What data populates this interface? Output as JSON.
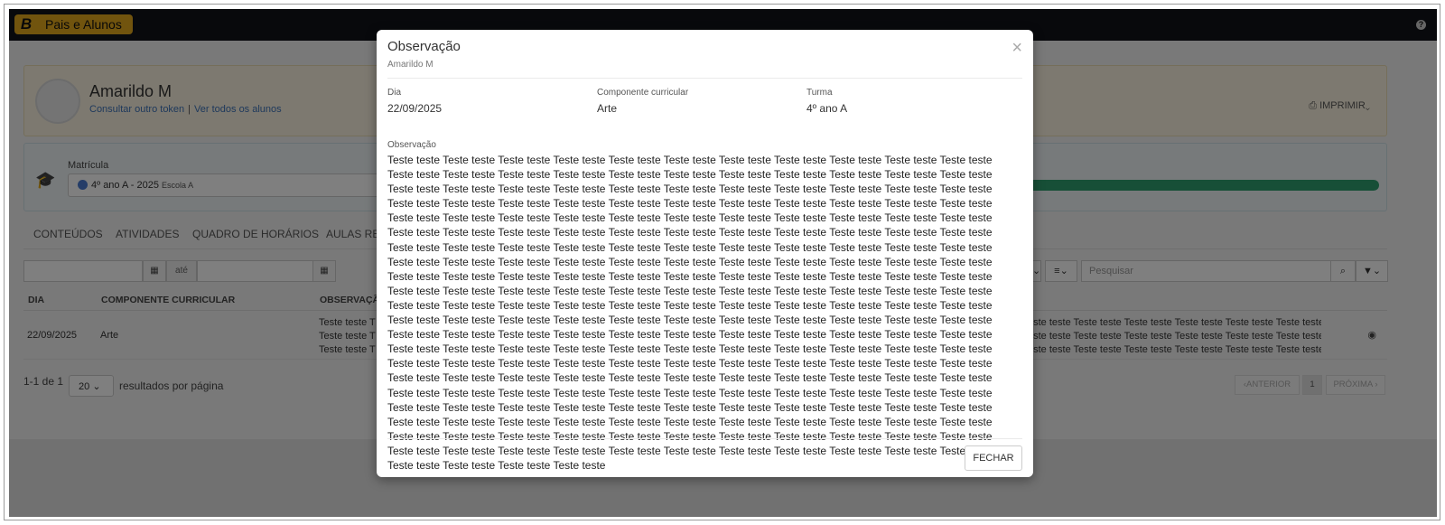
{
  "app": {
    "brand_letter": "B",
    "brand_name": "Pais e Alunos",
    "help_icon": "question-circle-icon"
  },
  "student": {
    "name": "Amarildo M",
    "link_token": "Consultar outro token",
    "link_separator": "|",
    "link_all": "Ver todos os alunos",
    "print_label": "IMPRIMIR"
  },
  "enrollment": {
    "label": "Matrícula",
    "value": "4º ano A - 2025",
    "school": "Escola A"
  },
  "tabs": [
    "CONTEÚDOS",
    "ATIVIDADES",
    "QUADRO DE HORÁRIOS",
    "AULAS REA"
  ],
  "filters": {
    "until_label": "até",
    "search_placeholder": "Pesquisar"
  },
  "table": {
    "headers": {
      "dia": "DIA",
      "componente": "COMPONENTE CURRICULAR",
      "observacao": "OBSERVAÇÃO"
    },
    "rows": [
      {
        "dia": "22/09/2025",
        "componente": "Arte",
        "obs_line1": "Teste teste T",
        "obs_line2": "Teste teste T",
        "obs_line3": "Teste teste T",
        "obs_tail1": "este teste Teste teste Teste teste Teste teste Teste teste Teste teste",
        "obs_tail2": "este teste Teste teste Teste teste Teste teste Teste teste Teste teste",
        "obs_tail3": "este teste Teste teste Teste teste Teste teste Teste teste Teste teste..."
      }
    ]
  },
  "pagination": {
    "summary": "1-1 de 1",
    "per_page": "20",
    "per_page_label": "resultados por página",
    "prev": "ANTERIOR",
    "current": "1",
    "next": "PRÓXIMA"
  },
  "modal": {
    "title": "Observação",
    "subtitle": "Amarildo M",
    "dia_label": "Dia",
    "dia_value": "22/09/2025",
    "comp_label": "Componente curricular",
    "comp_value": "Arte",
    "turma_label": "Turma",
    "turma_value": "4º ano A",
    "obs_label": "Observação",
    "obs_text": "Teste teste Teste teste Teste teste Teste teste Teste teste Teste teste Teste teste Teste teste Teste teste Teste teste Teste teste Teste teste Teste teste Teste teste Teste teste Teste teste Teste teste Teste teste Teste teste Teste teste Teste teste Teste teste Teste teste Teste teste Teste teste Teste teste Teste teste Teste teste Teste teste Teste teste Teste teste Teste teste Teste teste Teste teste Teste teste Teste teste Teste teste Teste teste Teste teste Teste teste Teste teste Teste teste Teste teste Teste teste Teste teste Teste teste Teste teste Teste teste Teste teste Teste teste Teste teste Teste teste Teste teste Teste teste Teste teste Teste teste Teste teste Teste teste Teste teste Teste teste Teste teste Teste teste Teste teste Teste teste Teste teste Teste teste Teste teste Teste teste Teste teste Teste teste Teste teste Teste teste Teste teste Teste teste Teste teste Teste teste Teste teste Teste teste Teste teste Teste teste Teste teste Teste teste Teste teste Teste teste Teste teste Teste teste Teste teste Teste teste Teste teste Teste teste Teste teste Teste teste Teste teste Teste teste Teste teste Teste teste Teste teste Teste teste Teste teste Teste teste Teste teste Teste teste Teste teste Teste teste Teste teste Teste teste Teste teste Teste teste Teste teste Teste teste Teste teste Teste teste Teste teste Teste teste Teste teste Teste teste Teste teste Teste teste Teste teste Teste teste Teste teste Teste teste Teste teste Teste teste Teste teste Teste teste Teste teste Teste teste Teste teste Teste teste Teste teste Teste teste Teste teste Teste teste Teste teste Teste teste Teste teste Teste teste Teste teste Teste teste Teste teste Teste teste Teste teste Teste teste Teste teste Teste teste Teste teste Teste teste Teste teste Teste teste Teste teste Teste teste Teste teste Teste teste Teste teste Teste teste Teste teste Teste teste Teste teste Teste teste Teste teste Teste teste Teste teste Teste teste Teste teste Teste teste Teste teste Teste teste Teste teste Teste teste Teste teste Teste teste Teste teste Teste teste Teste teste Teste teste Teste teste Teste teste Teste teste Teste teste Teste teste Teste teste Teste teste Teste teste Teste teste Teste teste Teste teste Teste teste Teste teste Teste teste Teste teste Teste teste Teste teste Teste teste Teste teste Teste teste Teste teste Teste teste Teste teste Teste teste Teste teste Teste teste Teste teste Teste teste Teste teste Teste teste Teste teste Teste teste Teste teste Teste teste Teste teste Teste teste Teste teste Teste teste Teste teste Teste teste Teste teste Teste teste Teste teste Teste teste Teste teste Teste teste Teste teste Teste teste Teste teste Teste teste Teste teste Teste teste Teste teste Teste teste Teste teste Teste teste Teste teste Teste teste Teste teste",
    "close_button": "FECHAR"
  },
  "colors": {
    "topbar": "#111218",
    "brand": "#e3a81c",
    "progress": "#2e9f6e",
    "link": "#3d72b8"
  }
}
